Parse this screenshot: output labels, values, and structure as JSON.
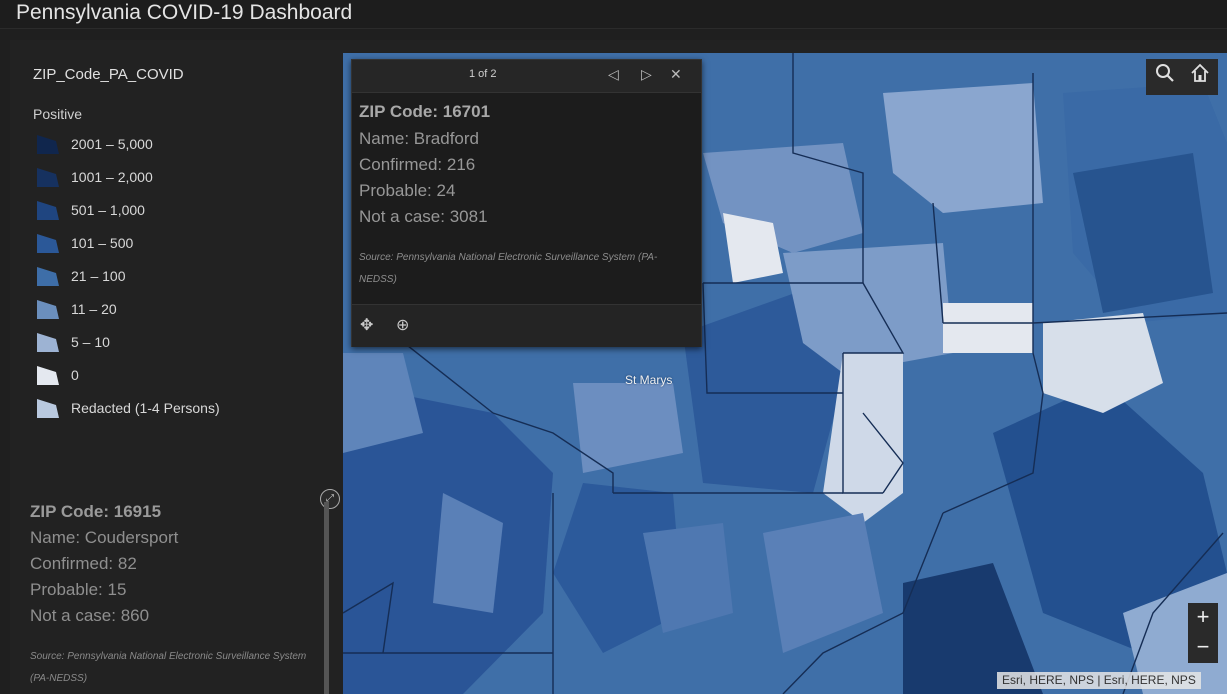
{
  "header": {
    "title": "Pennsylvania COVID-19 Dashboard"
  },
  "legend": {
    "layer_name": "ZIP_Code_PA_COVID",
    "field_name": "Positive",
    "items": [
      {
        "label": "2001 – 5,000",
        "color": "#10264d"
      },
      {
        "label": "1001 – 2,000",
        "color": "#16315f"
      },
      {
        "label": "501 – 1,000",
        "color": "#1f4580"
      },
      {
        "label": "101 – 500",
        "color": "#2b5898"
      },
      {
        "label": "21 – 100",
        "color": "#3e6ea8"
      },
      {
        "label": "11 – 20",
        "color": "#6b8fbd"
      },
      {
        "label": "5 – 10",
        "color": "#9db3d3"
      },
      {
        "label": "0",
        "color": "#e4e8ef"
      },
      {
        "label": "Redacted (1-4 Persons)",
        "color": "#b9c9df"
      }
    ]
  },
  "side_info": {
    "zip": "ZIP Code: 16915",
    "name": "Name: Coudersport",
    "confirmed": "Confirmed: 82",
    "probable": "Probable: 15",
    "not_case": "Not a case: 860",
    "source": "Source: Pennsylvania National Electronic Surveillance System (PA-NEDSS)"
  },
  "popup": {
    "pager": "1 of 2",
    "zip": "ZIP Code: 16701",
    "name": "Name: Bradford",
    "confirmed": "Confirmed: 216",
    "probable": "Probable: 24",
    "not_case": "Not a case: 3081",
    "source": "Source: Pennsylvania National Electronic Surveillance System (PA-NEDSS)"
  },
  "map": {
    "place_label": "St Marys",
    "attribution": "Esri, HERE, NPS | Esri, HERE, NPS",
    "zoom_in": "+",
    "zoom_out": "−"
  }
}
